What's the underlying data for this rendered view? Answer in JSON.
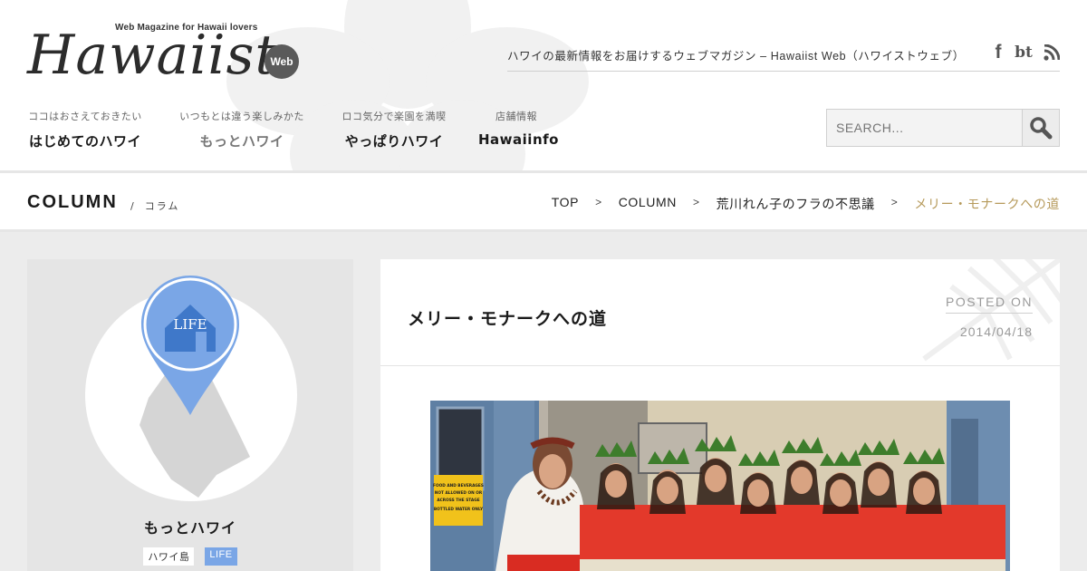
{
  "header": {
    "tagline_small": "Web Magazine for Hawaii lovers",
    "logo_text": "Hawaiist",
    "logo_badge": "Web",
    "site_description": "ハワイの最新情報をお届けするウェブマガジン – Hawaiist Web（ハワイストウェブ）",
    "social": [
      {
        "icon": "facebook-icon",
        "glyph": "f"
      },
      {
        "icon": "bt-icon",
        "glyph": "bt"
      },
      {
        "icon": "rss-icon"
      }
    ],
    "nav": [
      {
        "sub": "ココはおさえておきたい",
        "label": "はじめてのハワイ"
      },
      {
        "sub": "いつもとは違う楽しみかた",
        "label": "もっとハワイ"
      },
      {
        "sub": "ロコ気分で楽園を満喫",
        "label": "やっぱりハワイ"
      },
      {
        "sub": "店舗情報",
        "label": "Hawaiinfo"
      }
    ],
    "search": {
      "placeholder": "SEARCH..."
    }
  },
  "section": {
    "title": "COLUMN",
    "separator": "/",
    "subtitle": "コラム"
  },
  "breadcrumb": {
    "items": [
      "TOP",
      "COLUMN",
      "荒川れん子のフラの不思議",
      "メリー・モナークへの道"
    ],
    "separator": ">"
  },
  "sidebar": {
    "pin_label": "LIFE",
    "title": "もっとハワイ",
    "tags": [
      "ハワイ島",
      "LIFE"
    ]
  },
  "article": {
    "title": "メリー・モナークへの道",
    "posted_label": "POSTED ON",
    "posted_date": "2014/04/18",
    "photo_sign": [
      "FOOD AND BEVERAGES",
      "NOT ALLOWED ON OR",
      "ACROSS THE STAGE",
      "BOTTLED WATER ONLY"
    ]
  },
  "colors": {
    "accent_gold": "#b69a5b",
    "pin_blue": "#7aa6e6",
    "pin_blue_dark": "#3f78c9"
  }
}
